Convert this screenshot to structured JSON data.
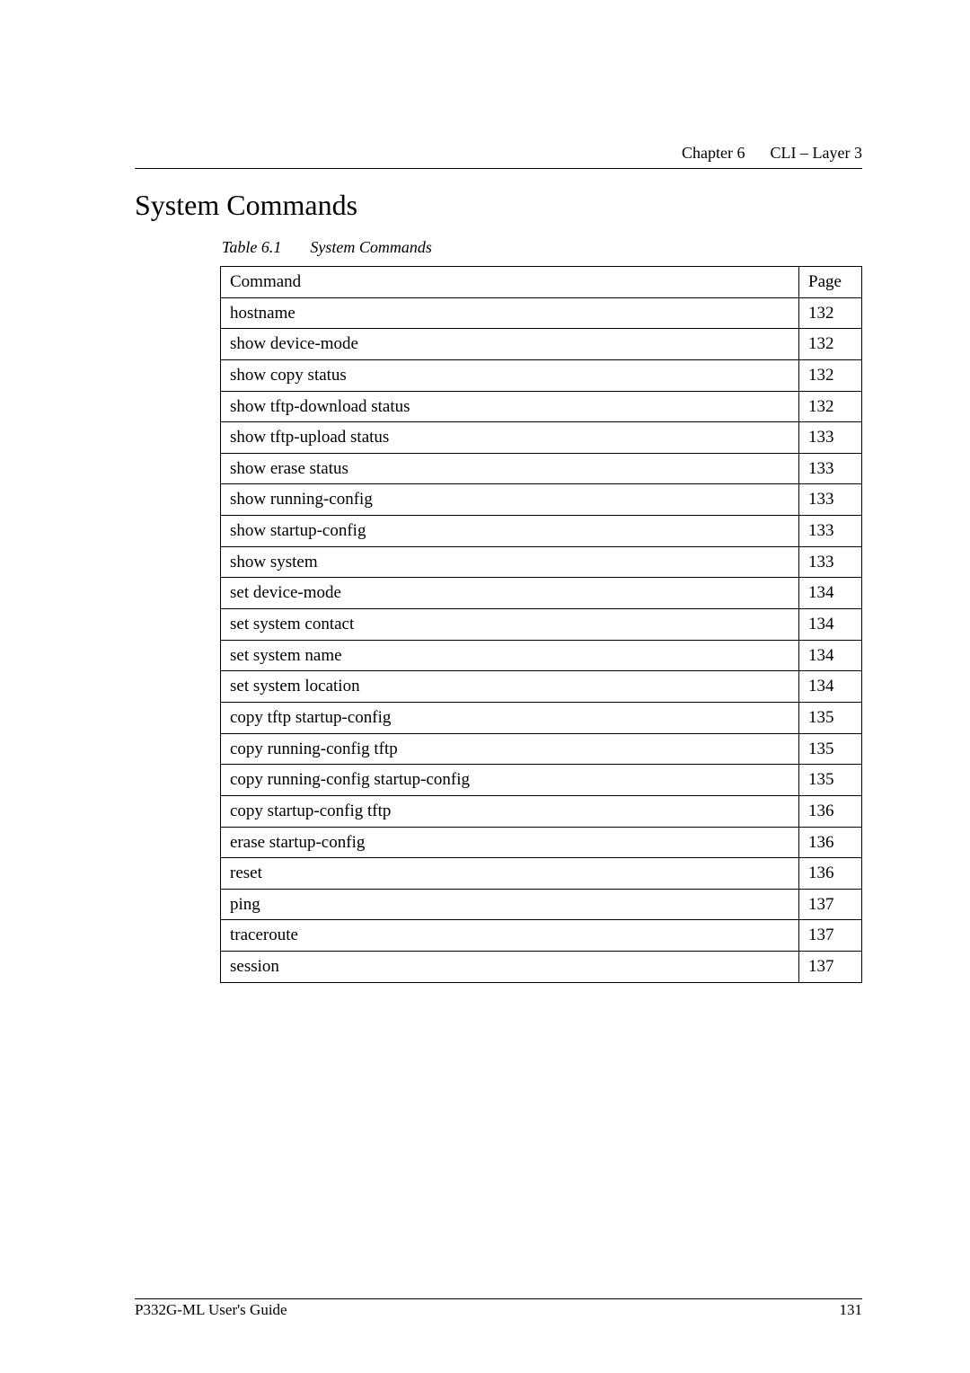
{
  "chapter": {
    "left": "Chapter 6",
    "right": "CLI – Layer 3"
  },
  "heading": "System Commands",
  "table_caption": {
    "label": "Table 6.1",
    "title": "System Commands"
  },
  "columns": {
    "command": "Command",
    "page": "Page"
  },
  "rows": [
    {
      "cmd": "hostname",
      "page": "132"
    },
    {
      "cmd": "show device-mode",
      "page": "132"
    },
    {
      "cmd": "show copy status",
      "page": "132"
    },
    {
      "cmd": "show tftp-download status",
      "page": "132"
    },
    {
      "cmd": "show tftp-upload status",
      "page": "133"
    },
    {
      "cmd": "show erase status",
      "page": "133"
    },
    {
      "cmd": "show running-config",
      "page": "133"
    },
    {
      "cmd": "show startup-config",
      "page": "133"
    },
    {
      "cmd": "show system",
      "page": "133"
    },
    {
      "cmd": "set device-mode",
      "page": "134"
    },
    {
      "cmd": "set system contact",
      "page": "134"
    },
    {
      "cmd": "set system name",
      "page": "134"
    },
    {
      "cmd": "set system location",
      "page": "134"
    },
    {
      "cmd": "copy tftp startup-config",
      "page": "135"
    },
    {
      "cmd": "copy running-config tftp",
      "page": "135"
    },
    {
      "cmd": "copy running-config startup-config",
      "page": "135"
    },
    {
      "cmd": "copy startup-config tftp",
      "page": "136"
    },
    {
      "cmd": "erase startup-config",
      "page": "136"
    },
    {
      "cmd": "reset",
      "page": "136"
    },
    {
      "cmd": "ping",
      "page": "137"
    },
    {
      "cmd": "traceroute",
      "page": "137"
    },
    {
      "cmd": "session",
      "page": "137"
    }
  ],
  "footer": {
    "left": "P332G-ML User's Guide",
    "right": "131"
  }
}
